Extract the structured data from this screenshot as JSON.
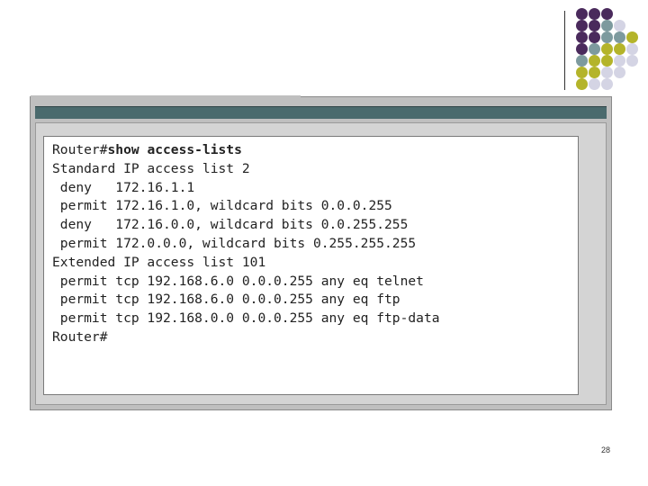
{
  "terminal": {
    "lines": [
      {
        "prompt": "Router#",
        "command": "show access-lists",
        "text": ""
      },
      {
        "prompt": "",
        "command": "",
        "text": "Standard IP access list 2"
      },
      {
        "prompt": "",
        "command": "",
        "text": " deny   172.16.1.1"
      },
      {
        "prompt": "",
        "command": "",
        "text": " permit 172.16.1.0, wildcard bits 0.0.0.255"
      },
      {
        "prompt": "",
        "command": "",
        "text": " deny   172.16.0.0, wildcard bits 0.0.255.255"
      },
      {
        "prompt": "",
        "command": "",
        "text": " permit 172.0.0.0, wildcard bits 0.255.255.255"
      },
      {
        "prompt": "",
        "command": "",
        "text": "Extended IP access list 101"
      },
      {
        "prompt": "",
        "command": "",
        "text": " permit tcp 192.168.6.0 0.0.0.255 any eq telnet"
      },
      {
        "prompt": "",
        "command": "",
        "text": " permit tcp 192.168.6.0 0.0.0.255 any eq ftp"
      },
      {
        "prompt": "",
        "command": "",
        "text": " permit tcp 192.168.0.0 0.0.0.255 any eq ftp-data"
      },
      {
        "prompt": "Router#",
        "command": "",
        "text": ""
      }
    ]
  },
  "slide": {
    "number": "28"
  },
  "colors": {
    "purple": "#4a2a5c",
    "teal": "#7d9a9e",
    "olive": "#b4b42a",
    "lavender": "#d4d4e4",
    "titlebar": "#4a6a6d"
  }
}
